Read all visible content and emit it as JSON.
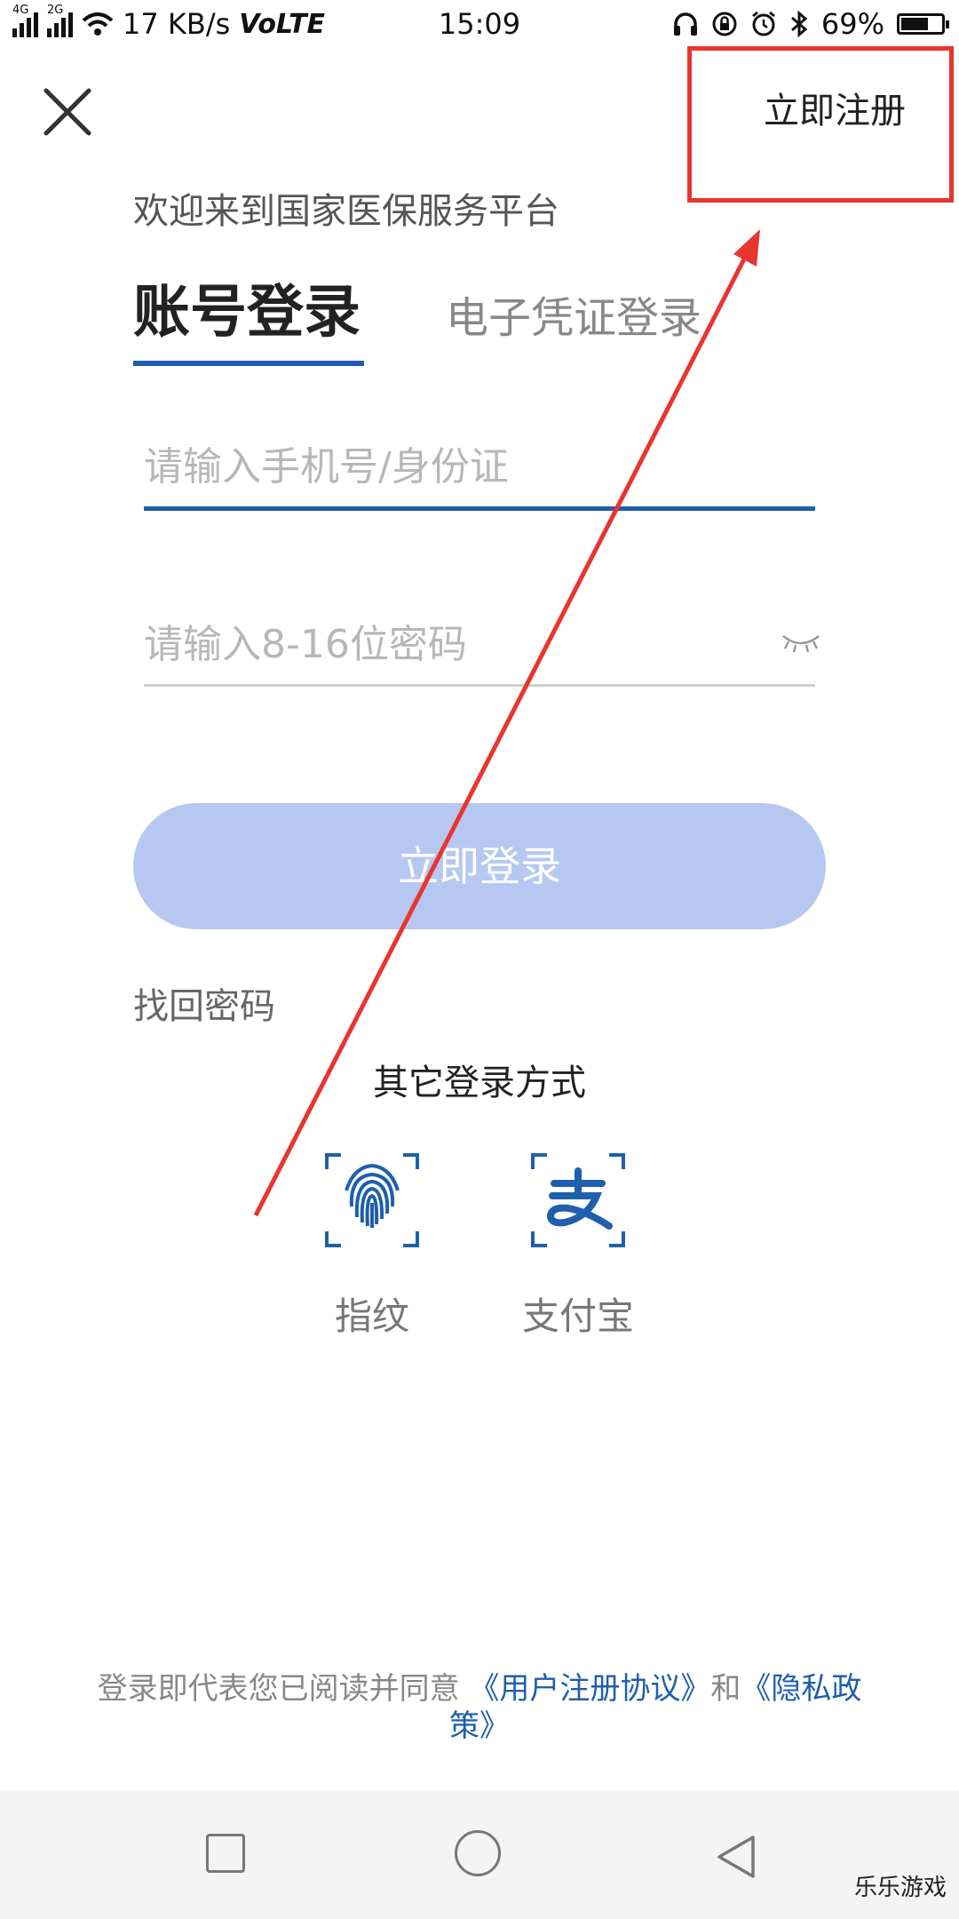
{
  "status_bar": {
    "net_tag_1": "4G",
    "net_tag_2": "2G",
    "speed": "17 KB/s",
    "volte": "VoLTE",
    "time": "15:09",
    "battery_text": "69%",
    "battery_level": 0.69
  },
  "header": {
    "close_icon": "close-icon",
    "register_label": "立即注册"
  },
  "welcome": "欢迎来到国家医保服务平台",
  "tabs": [
    {
      "label": "账号登录",
      "active": true
    },
    {
      "label": "电子凭证登录",
      "active": false
    }
  ],
  "form": {
    "phone_placeholder": "请输入手机号/身份证",
    "password_placeholder": "请输入8-16位密码",
    "eye_icon": "eye-closed-icon",
    "login_label": "立即登录"
  },
  "forgot_label": "找回密码",
  "other_login": {
    "title": "其它登录方式",
    "options": [
      {
        "label": "指纹",
        "icon": "fingerprint-icon"
      },
      {
        "label": "支付宝",
        "icon": "alipay-icon"
      }
    ]
  },
  "agreement": {
    "prefix": "登录即代表您已阅读并同意",
    "link_user": "《用户注册协议》",
    "and": "和",
    "link_privacy": "《隐私政策》"
  },
  "watermark": "乐乐游戏",
  "colors": {
    "primary": "#1f5fab",
    "button_disabled": "#b6c8f2",
    "annotation_red": "#e8352f"
  }
}
